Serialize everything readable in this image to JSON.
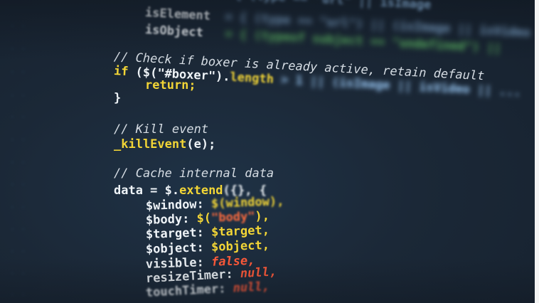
{
  "lines": {
    "l1": "isElement",
    "l1_rest": "= { (type == \"url\") || (isImage || isVideo",
    "l2": "isObject",
    "l2_rest": "= { (typeof subject == \"undefined\") ||",
    "l3": "// Check if boxer is already active, retain default",
    "l4_a": "if",
    "l4_b": " ($(\"#boxer\").",
    "l4_c": "length",
    "l4_d": " > 1 || (isImage || isVideo || ...",
    "l5": "return;",
    "l6": "}",
    "l7": "// Kill event",
    "l8_a": "_killEvent",
    "l8_b": "(e);",
    "l9": "// Cache internal data",
    "l10_a": "data = $.",
    "l10_b": "extend",
    "l10_c": "({}, {",
    "l11_a": "$window: ",
    "l11_b": "$(window),",
    "l12_a": "$body: ",
    "l12_b": "$(",
    "l12_c": "\"body\"",
    "l12_d": "),",
    "l13_a": "$target: ",
    "l13_b": "$target,",
    "l14_a": "$object: ",
    "l14_b": "$object,",
    "l15_a": "visible: ",
    "l15_b": "false,",
    "l16_a": "resizeTimer: ",
    "l16_b": "null,",
    "l17_a": "touchTimer: ",
    "l17_b": "null,"
  }
}
